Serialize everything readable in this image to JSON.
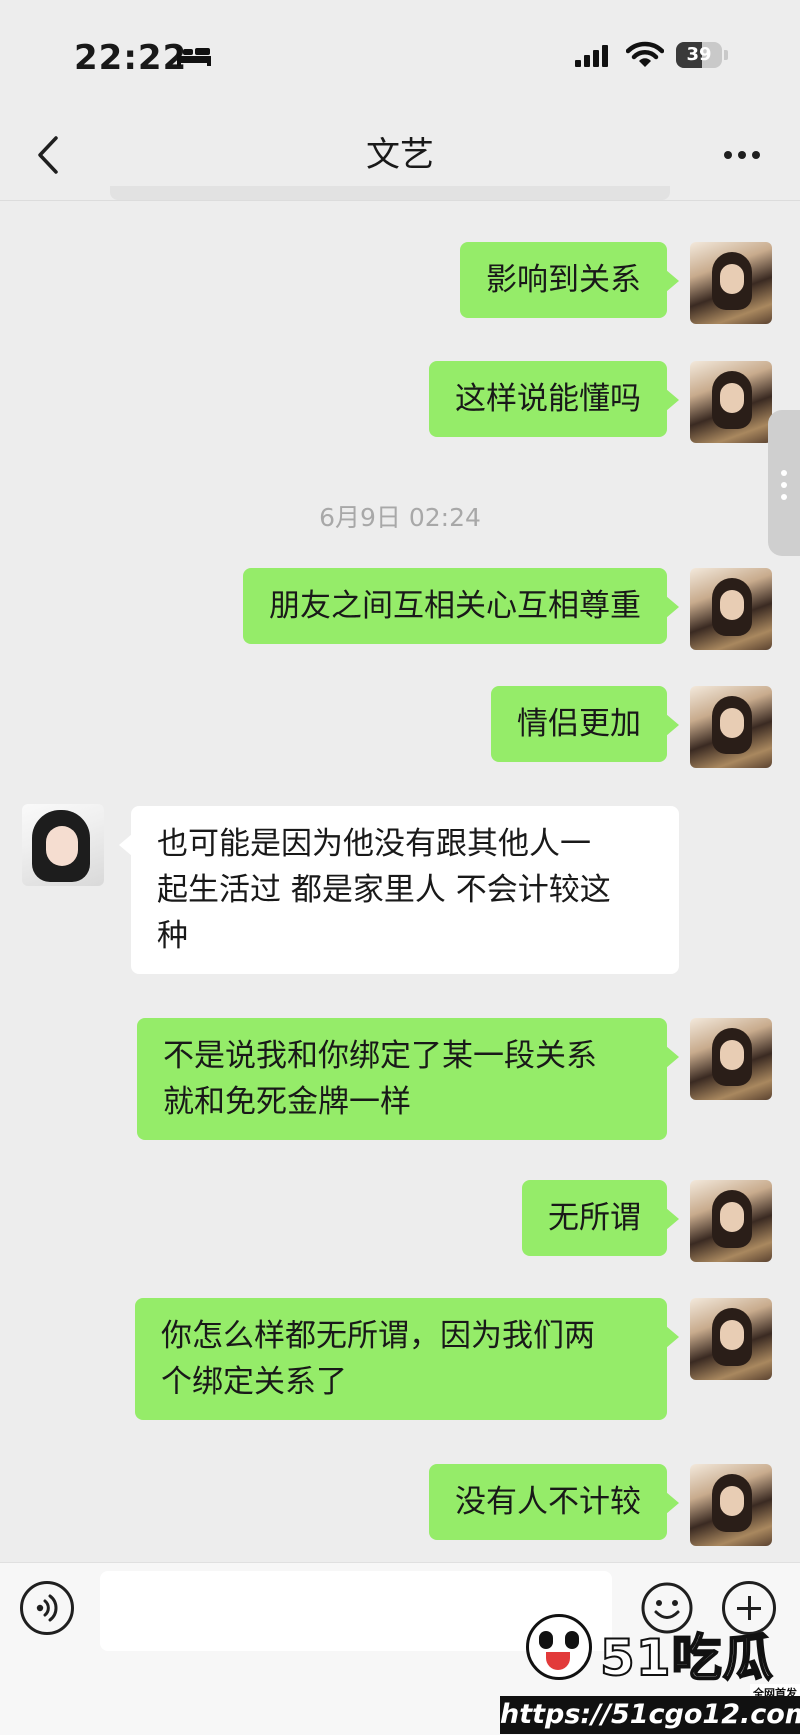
{
  "status_bar": {
    "time": "22:22",
    "battery": "39"
  },
  "header": {
    "title": "文艺"
  },
  "messages": [
    {
      "sender": "self",
      "text": "影响到关系"
    },
    {
      "sender": "self",
      "text": "这样说能懂吗"
    },
    {
      "sender": "self",
      "text": "朋友之间互相关心互相尊重"
    },
    {
      "sender": "self",
      "text": "情侣更加"
    },
    {
      "sender": "other",
      "text": "也可能是因为他没有跟其他人一\n起生活过 都是家里人 不会计较这\n种"
    },
    {
      "sender": "self",
      "text": "不是说我和你绑定了某一段关系\n就和免死金牌一样"
    },
    {
      "sender": "self",
      "text": "无所谓"
    },
    {
      "sender": "self",
      "text": "你怎么样都无所谓，因为我们两\n个绑定关系了"
    },
    {
      "sender": "self",
      "text": "没有人不计较"
    }
  ],
  "timestamp": "6月9日 02:24",
  "input": {
    "value": ""
  },
  "watermark": {
    "brand": "51吃瓜",
    "tag": "全网首发",
    "url": "https://51cgo12.com"
  },
  "icons": {
    "back": "chevron-left-icon",
    "more": "more-dots-icon",
    "voice": "voice-icon",
    "emoji": "emoji-icon",
    "plus": "plus-icon"
  },
  "colors": {
    "self_bubble": "#95ec69",
    "other_bubble": "#ffffff",
    "background": "#ededed"
  }
}
